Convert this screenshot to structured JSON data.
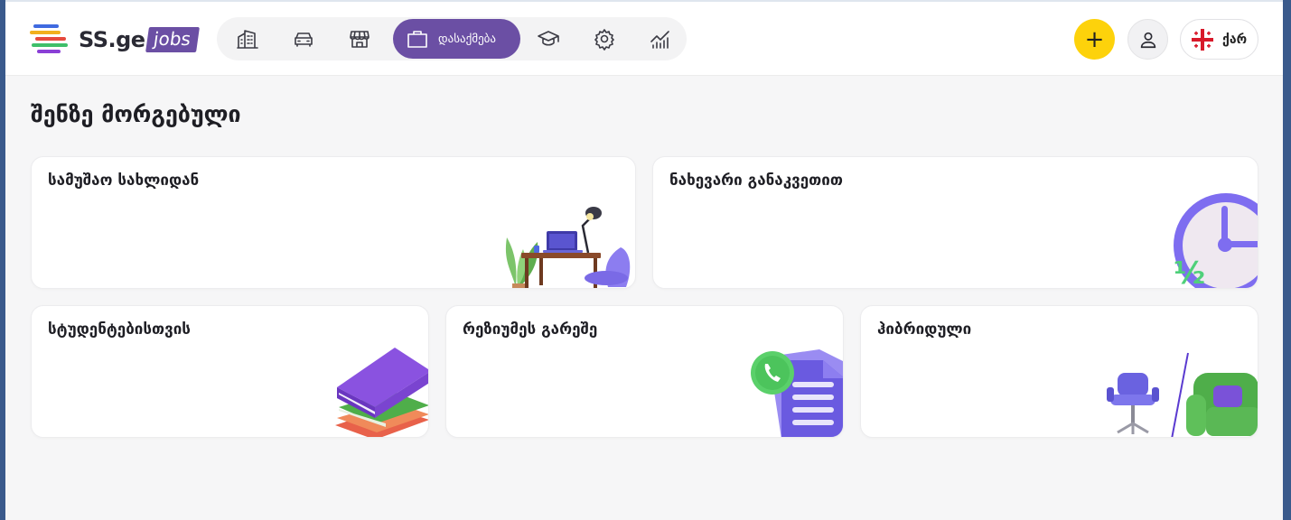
{
  "header": {
    "logo_text": "SS.ge",
    "logo_tag": "jobs",
    "nav": [
      {
        "icon": "building-icon"
      },
      {
        "icon": "car-icon"
      },
      {
        "icon": "store-icon"
      },
      {
        "icon": "briefcase-icon",
        "label": "დასაქმება",
        "active": true
      },
      {
        "icon": "graduation-cap-icon"
      },
      {
        "icon": "gear-icon"
      },
      {
        "icon": "chart-icon"
      }
    ],
    "add_label": "+",
    "lang_label": "ქარ"
  },
  "main": {
    "section_title": "შენზე მორგებული",
    "cards": [
      {
        "title": "სამუშაო სახლიდან",
        "illustration": "desk-illustration"
      },
      {
        "title": "ნახევარი განაკვეთით",
        "illustration": "clock-illustration"
      },
      {
        "title": "სტუდენტებისთვის",
        "illustration": "books-illustration"
      },
      {
        "title": "რეზიუმეს გარეშე",
        "illustration": "document-phone-illustration"
      },
      {
        "title": "ჰიბრიდული",
        "illustration": "chairs-illustration"
      }
    ]
  },
  "colors": {
    "brand_purple": "#6b4fa4",
    "accent_yellow": "#fdd20b",
    "background": "#f6f6f7"
  }
}
